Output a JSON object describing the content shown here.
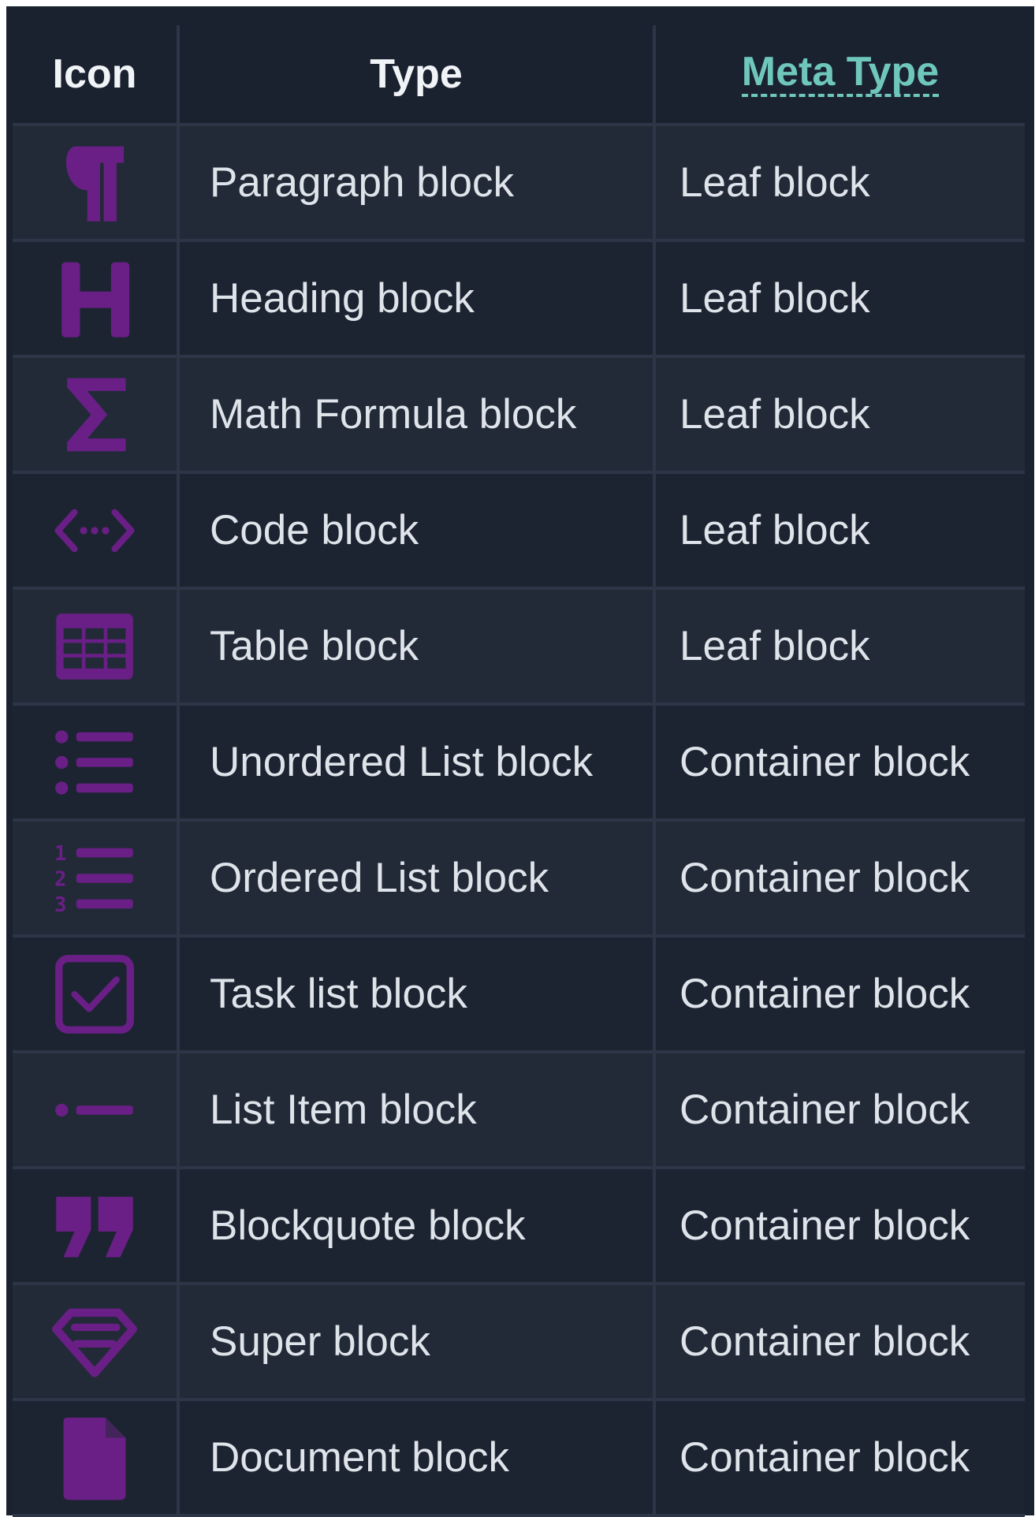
{
  "table": {
    "headers": {
      "icon": "Icon",
      "type": "Type",
      "meta_type": "Meta Type"
    },
    "rows": [
      {
        "icon": "paragraph-icon",
        "type": "Paragraph block",
        "meta_type": "Leaf block"
      },
      {
        "icon": "heading-icon",
        "type": "Heading block",
        "meta_type": "Leaf block"
      },
      {
        "icon": "math-sigma-icon",
        "type": "Math Formula block",
        "meta_type": "Leaf block"
      },
      {
        "icon": "code-icon",
        "type": "Code block",
        "meta_type": "Leaf block"
      },
      {
        "icon": "table-icon",
        "type": "Table block",
        "meta_type": "Leaf block"
      },
      {
        "icon": "unordered-list-icon",
        "type": "Unordered List block",
        "meta_type": "Container block"
      },
      {
        "icon": "ordered-list-icon",
        "type": "Ordered List block",
        "meta_type": "Container block"
      },
      {
        "icon": "task-list-icon",
        "type": "Task list block",
        "meta_type": "Container block"
      },
      {
        "icon": "list-item-icon",
        "type": "List Item block",
        "meta_type": "Container block"
      },
      {
        "icon": "blockquote-icon",
        "type": "Blockquote block",
        "meta_type": "Container block"
      },
      {
        "icon": "super-block-icon",
        "type": "Super block",
        "meta_type": "Container block"
      },
      {
        "icon": "document-icon",
        "type": "Document block",
        "meta_type": "Container block"
      }
    ]
  },
  "colors": {
    "background": "#1a2230",
    "row_odd": "#222a38",
    "row_even": "#1c2432",
    "icon": "#6a1f86",
    "link": "#6fc7bb",
    "text": "#dfe4ea"
  }
}
